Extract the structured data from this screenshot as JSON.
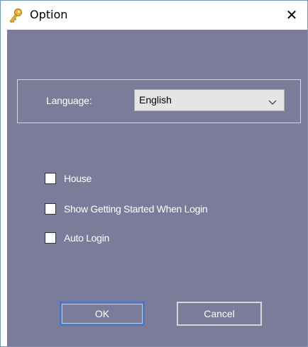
{
  "window": {
    "title": "Option",
    "icon": "key-icon",
    "close_glyph": "✕"
  },
  "language": {
    "label": "Language:",
    "selected": "English"
  },
  "options": [
    {
      "label": "House",
      "checked": false
    },
    {
      "label": "Show Getting Started When Login",
      "checked": false
    },
    {
      "label": "Auto Login",
      "checked": false
    }
  ],
  "buttons": {
    "ok": "OK",
    "cancel": "Cancel"
  },
  "colors": {
    "background": "#7a7c9a",
    "ok_focus_border": "#3a79d1",
    "window_border": "#6d97c4"
  }
}
